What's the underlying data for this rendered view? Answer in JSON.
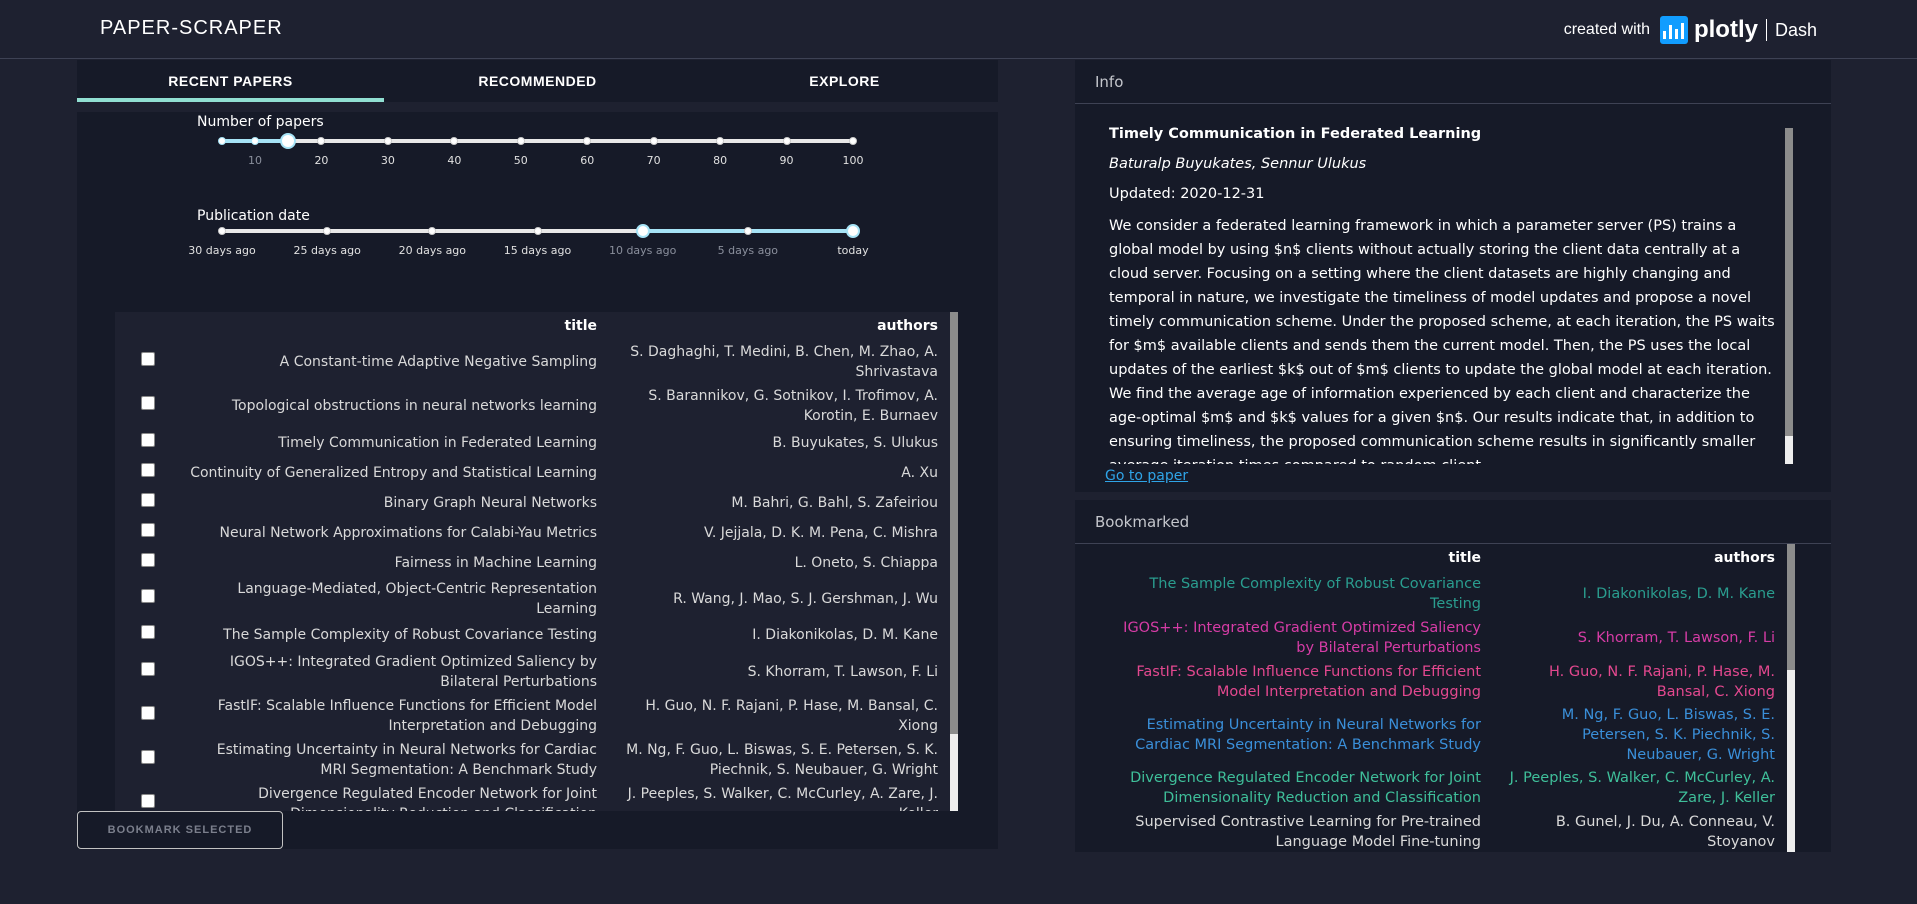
{
  "header": {
    "title": "PAPER-SCRAPER",
    "created_with": "created with",
    "plotly": "plotly",
    "dash": "Dash"
  },
  "tabs": [
    {
      "label": "RECENT PAPERS",
      "active": true
    },
    {
      "label": "RECOMMENDED",
      "active": false
    },
    {
      "label": "EXPLORE",
      "active": false
    }
  ],
  "controls": {
    "num_papers": {
      "label": "Number of papers",
      "marks": [
        "10",
        "20",
        "30",
        "40",
        "50",
        "60",
        "70",
        "80",
        "90",
        "100"
      ],
      "value": 15
    },
    "pub_date": {
      "label": "Publication date",
      "marks": [
        "30 days ago",
        "25 days ago",
        "20 days ago",
        "15 days ago",
        "10 days ago",
        "5 days ago",
        "today"
      ],
      "range": [
        "10 days ago",
        "today"
      ]
    }
  },
  "recent_table": {
    "columns": {
      "title": "title",
      "authors": "authors"
    },
    "rows": [
      {
        "title": "A Constant-time Adaptive Negative Sampling",
        "authors": "S. Daghaghi, T. Medini, B. Chen, M. Zhao, A. Shrivastava"
      },
      {
        "title": "Topological obstructions in neural networks learning",
        "authors": "S. Barannikov, G. Sotnikov, I. Trofimov, A. Korotin, E. Burnaev"
      },
      {
        "title": "Timely Communication in Federated Learning",
        "authors": "B. Buyukates, S. Ulukus"
      },
      {
        "title": "Continuity of Generalized Entropy and Statistical Learning",
        "authors": "A. Xu"
      },
      {
        "title": "Binary Graph Neural Networks",
        "authors": "M. Bahri, G. Bahl, S. Zafeiriou"
      },
      {
        "title": "Neural Network Approximations for Calabi-Yau Metrics",
        "authors": "V. Jejjala, D. K. M. Pena, C. Mishra"
      },
      {
        "title": "Fairness in Machine Learning",
        "authors": "L. Oneto, S. Chiappa"
      },
      {
        "title": "Language-Mediated, Object-Centric Representation Learning",
        "authors": "R. Wang, J. Mao, S. J. Gershman, J. Wu"
      },
      {
        "title": "The Sample Complexity of Robust Covariance Testing",
        "authors": "I. Diakonikolas, D. M. Kane"
      },
      {
        "title": "IGOS++: Integrated Gradient Optimized Saliency by Bilateral Perturbations",
        "authors": "S. Khorram, T. Lawson, F. Li"
      },
      {
        "title": "FastIF: Scalable Influence Functions for Efficient Model Interpretation and Debugging",
        "authors": "H. Guo, N. F. Rajani, P. Hase, M. Bansal, C. Xiong"
      },
      {
        "title": "Estimating Uncertainty in Neural Networks for Cardiac MRI Segmentation: A Benchmark Study",
        "authors": "M. Ng, F. Guo, L. Biswas, S. E. Petersen, S. K. Piechnik, S. Neubauer, G. Wright"
      },
      {
        "title": "Divergence Regulated Encoder Network for Joint Dimensionality Reduction and Classification",
        "authors": "J. Peeples, S. Walker, C. McCurley, A. Zare, J. Keller"
      }
    ]
  },
  "bookmark_button": "BOOKMARK SELECTED",
  "info": {
    "panel_title": "Info",
    "paper_title": "Timely Communication in Federated Learning",
    "authors": "Baturalp Buyukates, Sennur Ulukus",
    "updated": "Updated: 2020-12-31",
    "abstract": "We consider a federated learning framework in which a parameter server (PS) trains a global model by using $n$ clients without actually storing the client data centrally at a cloud server. Focusing on a setting where the client datasets are highly changing and temporal in nature, we investigate the timeliness of model updates and propose a novel timely communication scheme. Under the proposed scheme, at each iteration, the PS waits for $m$ available clients and sends them the current model. Then, the PS uses the local updates of the earliest $k$ out of $m$ clients to update the global model at each iteration. We find the average age of information experienced by each client and characterize the age-optimal $m$ and $k$ values for a given $n$. Our results indicate that, in addition to ensuring timeliness, the proposed communication scheme results in significantly smaller average iteration times compared to random client",
    "link": "Go to paper"
  },
  "bookmarked": {
    "panel_title": "Bookmarked",
    "columns": {
      "title": "title",
      "authors": "authors"
    },
    "rows": [
      {
        "title": "The Sample Complexity of Robust Covariance Testing",
        "authors": "I. Diakonikolas, D. M. Kane",
        "color": "#2a9d8f"
      },
      {
        "title": "IGOS++: Integrated Gradient Optimized Saliency by Bilateral Perturbations",
        "authors": "S. Khorram, T. Lawson, F. Li",
        "color": "#d63ca6"
      },
      {
        "title": "FastIF: Scalable Influence Functions for Efficient Model Interpretation and Debugging",
        "authors": "H. Guo, N. F. Rajani, P. Hase, M. Bansal, C. Xiong",
        "color": "#e3488f"
      },
      {
        "title": "Estimating Uncertainty in Neural Networks for Cardiac MRI Segmentation: A Benchmark Study",
        "authors": "M. Ng, F. Guo, L. Biswas, S. E. Petersen, S. K. Piechnik, S. Neubauer, G. Wright",
        "color": "#3a8fd9"
      },
      {
        "title": "Divergence Regulated Encoder Network for Joint Dimensionality Reduction and Classification",
        "authors": "J. Peeples, S. Walker, C. McCurley, A. Zare, J. Keller",
        "color": "#3fbf9a"
      },
      {
        "title": "Supervised Contrastive Learning for Pre-trained Language Model Fine-tuning",
        "authors": "B. Gunel, J. Du, A. Conneau, V. Stoyanov",
        "color": "#d9d9d9"
      }
    ]
  }
}
